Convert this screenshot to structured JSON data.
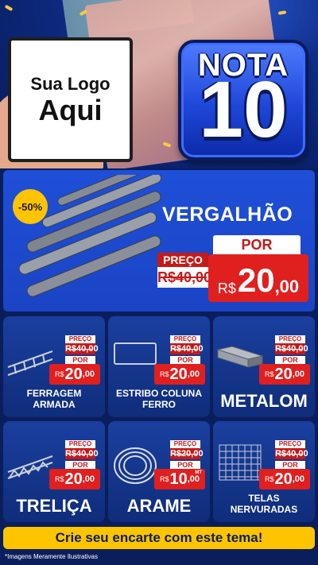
{
  "header": {
    "logo": {
      "line1": "Sua Logo",
      "line2": "Aqui"
    },
    "badge": {
      "word": "NOTA",
      "number": "10"
    }
  },
  "hero": {
    "title": "VERGALHÃO",
    "discount": "-50%",
    "price_label": "PREÇO",
    "old_price": "R$40,00",
    "por_label": "POR",
    "currency": "R$",
    "new_price_int": "20",
    "new_price_dec": ",00"
  },
  "products": [
    {
      "name": "FERRAGEM ARMADA",
      "preco_label": "PREÇO",
      "old": "R$40,00",
      "por_label": "POR",
      "currency": "R$",
      "int": "20",
      "dec": ",00",
      "unit": ""
    },
    {
      "name": "ESTRIBO COLUNA FERRO",
      "preco_label": "PREÇO",
      "old": "R$40,00",
      "por_label": "POR",
      "currency": "R$",
      "int": "20",
      "dec": ",00",
      "unit": ""
    },
    {
      "name": "METALOM",
      "preco_label": "PREÇO",
      "old": "R$40,00",
      "por_label": "POR",
      "currency": "R$",
      "int": "20",
      "dec": ",00",
      "unit": ""
    },
    {
      "name": "TRELIÇA",
      "preco_label": "PREÇO",
      "old": "R$40,00",
      "por_label": "POR",
      "currency": "R$",
      "int": "20",
      "dec": ",00",
      "unit": ""
    },
    {
      "name": "ARAME",
      "preco_label": "PREÇO",
      "old": "R$20,00",
      "por_label": "POR",
      "currency": "R$",
      "int": "10",
      "dec": ",00",
      "unit": "MT"
    },
    {
      "name": "TELAS NERVURADAS",
      "preco_label": "PREÇO",
      "old": "R$40,00",
      "por_label": "POR",
      "currency": "R$",
      "int": "20",
      "dec": ",00",
      "unit": ""
    }
  ],
  "cta": {
    "label": "Crie seu encarte com este tema!"
  },
  "footer": {
    "note": "*Imagens Meramente Ilustrativas"
  },
  "colors": {
    "brand_blue": "#1f4fd8",
    "price_red": "#e01f1f",
    "cta_yellow": "#ffc400"
  }
}
